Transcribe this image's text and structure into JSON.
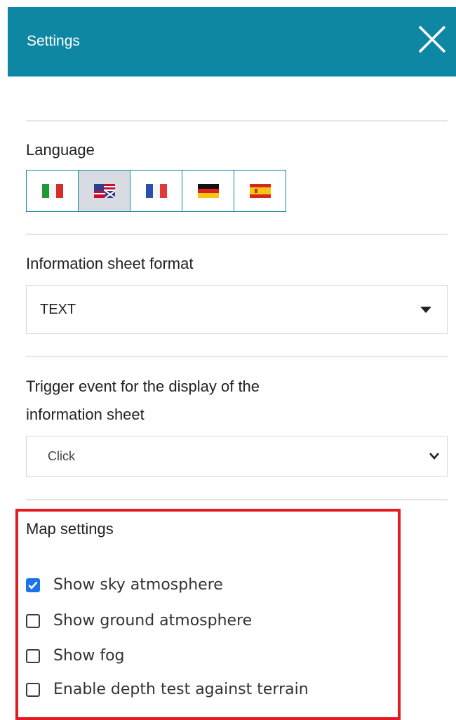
{
  "header": {
    "title": "Settings"
  },
  "language": {
    "label": "Language",
    "flags": [
      {
        "name": "italian",
        "active": false
      },
      {
        "name": "english",
        "active": true
      },
      {
        "name": "french",
        "active": false
      },
      {
        "name": "german",
        "active": false
      },
      {
        "name": "spanish",
        "active": false
      }
    ]
  },
  "info_sheet_format": {
    "label": "Information sheet format",
    "value": "TEXT"
  },
  "trigger_event": {
    "label_line1": "Trigger event for the display of the",
    "label_line2": "information sheet",
    "value": "Click"
  },
  "map_settings": {
    "title": "Map settings",
    "options": [
      {
        "label": "Show sky atmosphere",
        "checked": true
      },
      {
        "label": "Show ground atmosphere",
        "checked": false
      },
      {
        "label": "Show fog",
        "checked": false
      },
      {
        "label": "Enable depth test against terrain",
        "checked": false
      }
    ]
  },
  "colors": {
    "header_bg": "#0e87a4",
    "highlight": "#e31b23",
    "check_accent": "#1a73e8"
  }
}
